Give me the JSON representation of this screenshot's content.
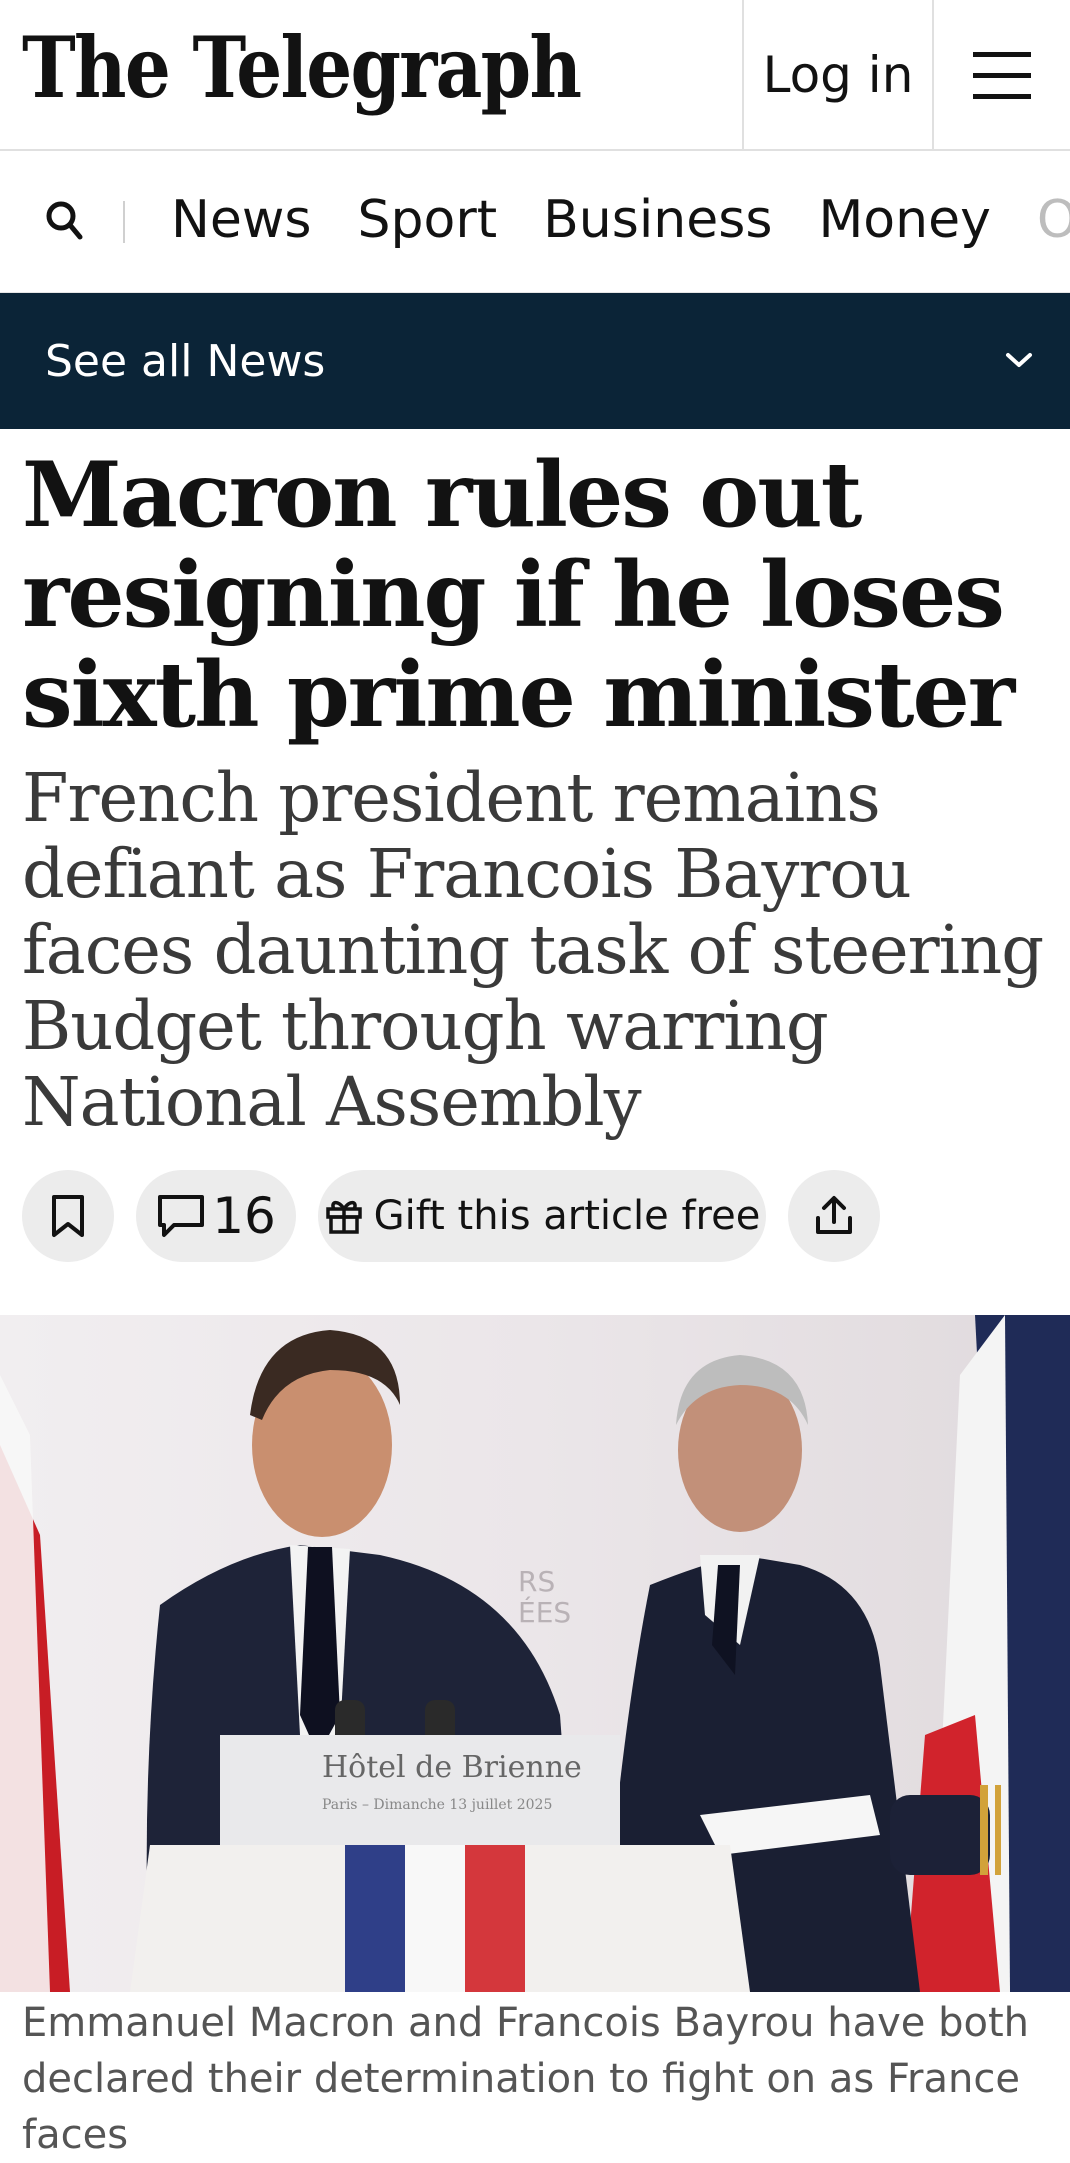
{
  "header": {
    "logo_text": "The Telegraph",
    "login_label": "Log in",
    "menu_icon": "hamburger-menu-icon"
  },
  "nav": {
    "search_icon": "search-icon",
    "items": [
      "News",
      "Sport",
      "Business",
      "Money",
      "Op"
    ]
  },
  "section_bar": {
    "label": "See all News",
    "icon": "chevron-down-icon"
  },
  "article": {
    "headline": "Macron rules out resigning if he loses sixth prime minister",
    "standfirst": "French president remains defiant as Francois Bayrou faces daunting task of steering Budget through warring National Assembly",
    "actions": {
      "bookmark_icon": "bookmark-icon",
      "comment_count": "16",
      "gift_label": "Gift this article free",
      "share_icon": "share-icon"
    },
    "image": {
      "podium_title": "Hôtel de Brienne",
      "podium_subtitle": "Paris – Dimanche 13 juillet 2025",
      "backdrop_text_1": "RS",
      "backdrop_text_2": "ÉES"
    },
    "caption": "Emmanuel Macron and Francois Bayrou have both declared their determination to fight on as France faces"
  },
  "colors": {
    "section_bar_bg": "#0b2437",
    "pill_bg": "#ececec",
    "text": "#121212",
    "caption": "#555555"
  }
}
